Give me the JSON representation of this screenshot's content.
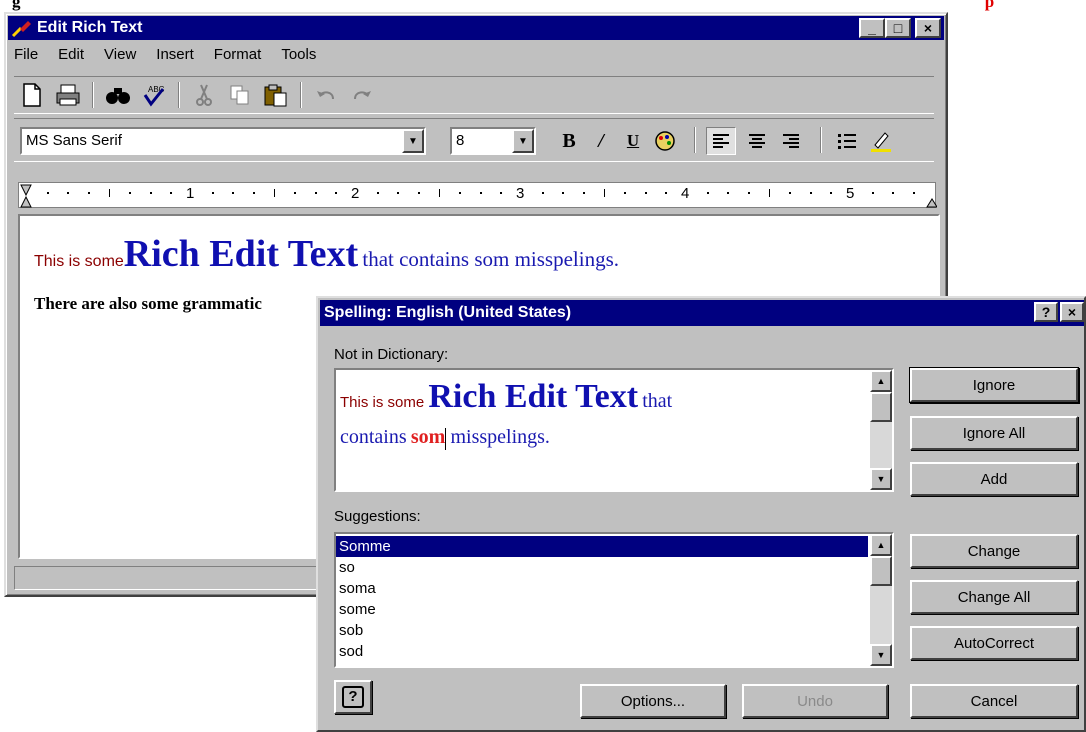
{
  "caption": {
    "text": "g",
    "red": "p"
  },
  "window": {
    "title": "Edit Rich Text",
    "controls": [
      "_",
      "□",
      "×"
    ]
  },
  "menu": [
    "File",
    "Edit",
    "View",
    "Insert",
    "Format",
    "Tools"
  ],
  "toolbar_icons": [
    "new-doc-icon",
    "print-icon",
    "find-icon",
    "spell-check-icon",
    "cut-icon",
    "copy-icon",
    "paste-icon",
    "undo-icon",
    "redo-icon"
  ],
  "format_bar": {
    "font": "MS Sans Serif",
    "size": "8",
    "bold": "B",
    "italic": "/",
    "underline": "U",
    "color_icon": "color-palette-icon",
    "align_icons": [
      "align-left-icon",
      "align-center-icon",
      "align-right-icon"
    ],
    "bullets_icon": "bullets-icon",
    "highlight_icon": "highlight-pen-icon"
  },
  "ruler": [
    "1",
    "2",
    "3",
    "4",
    "5"
  ],
  "document": {
    "line1_small": "This is some",
    "line1_big": "Rich Edit Text",
    "line1_rest": "that contains som misspelings.",
    "line2": "There are also some grammatic"
  },
  "dialog": {
    "title": "Spelling: English (United States)",
    "help_btn": "?",
    "close_btn": "×",
    "not_in_dict_label": "Not in Dictionary:",
    "preview": {
      "small": "This is some",
      "big": "Rich Edit Text",
      "after_big": "that",
      "before_err": "contains",
      "error_word": "som",
      "after_err": "misspelings."
    },
    "suggestions_label": "Suggestions:",
    "suggestions": [
      "Somme",
      "so",
      "soma",
      "some",
      "sob",
      "sod"
    ],
    "buttons": {
      "ignore": "Ignore",
      "ignore_all": "Ignore All",
      "add": "Add",
      "change": "Change",
      "change_all": "Change All",
      "autocorrect": "AutoCorrect",
      "options": "Options...",
      "undo": "Undo",
      "cancel": "Cancel",
      "help_icon_label": "?"
    }
  }
}
